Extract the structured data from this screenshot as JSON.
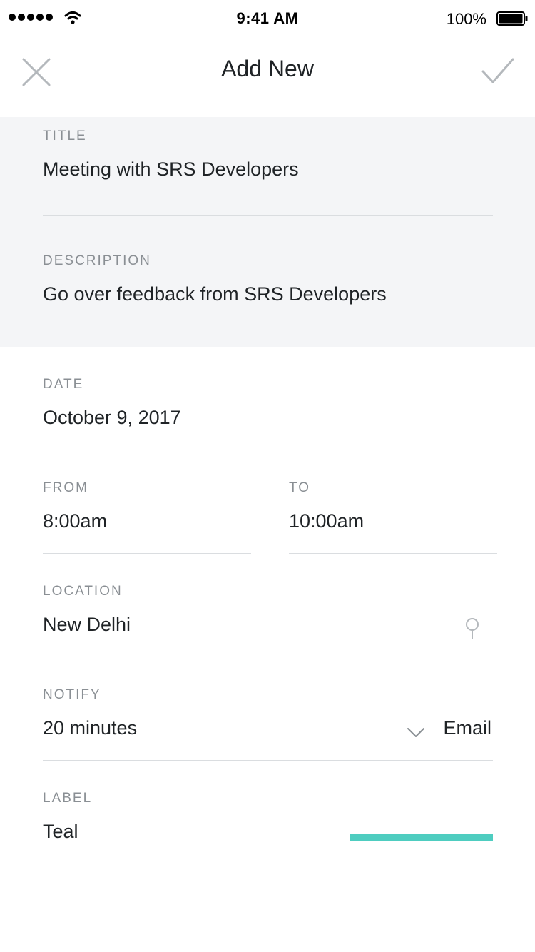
{
  "status_bar": {
    "time": "9:41 AM",
    "battery_percent": "100%",
    "signal_bars": 5,
    "icons": [
      "signal-icon",
      "wifi-icon",
      "battery-icon"
    ]
  },
  "nav": {
    "title": "Add New",
    "close_icon": "close-icon",
    "confirm_icon": "checkmark-icon"
  },
  "form": {
    "title": {
      "label": "TITLE",
      "value": "Meeting with SRS Developers"
    },
    "description": {
      "label": "DESCRIPTION",
      "value": "Go over feedback from SRS Developers"
    },
    "date": {
      "label": "DATE",
      "value": "October 9, 2017"
    },
    "from": {
      "label": "FROM",
      "value": "8:00am"
    },
    "to": {
      "label": "TO",
      "value": "10:00am"
    },
    "location": {
      "label": "LOCATION",
      "value": "New Delhi",
      "icon": "map-pin-icon"
    },
    "notify": {
      "label": "NOTIFY",
      "value": "20 minutes",
      "method": "Email",
      "icon": "chevron-down-icon"
    },
    "label": {
      "label": "LABEL",
      "value": "Teal",
      "color": "#4ecdc0"
    }
  },
  "colors": {
    "grey_background": "#f4f5f7",
    "label_text": "#8a8f94",
    "value_text": "#1f2326",
    "divider": "#dadde0",
    "icon": "#b4b8bc"
  }
}
